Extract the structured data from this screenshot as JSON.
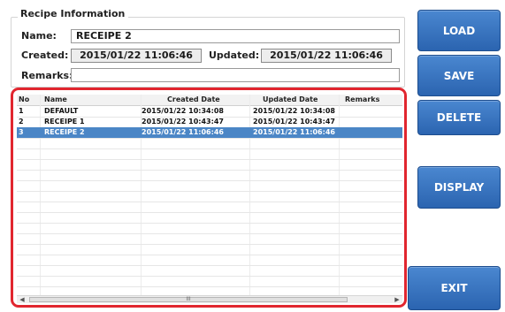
{
  "recipe_info": {
    "title": "Recipe Information",
    "name_label": "Name:",
    "name_value": "RECEIPE 2",
    "created_label": "Created:",
    "created_value": "2015/01/22 11:06:46",
    "updated_label": "Updated:",
    "updated_value": "2015/01/22 11:06:46",
    "remarks_label": "Remarks:",
    "remarks_value": ""
  },
  "table": {
    "columns": [
      "No",
      "Name",
      "Created Date",
      "Updated Date",
      "Remarks"
    ],
    "rows": [
      {
        "no": "1",
        "name": "DEFAULT",
        "created": "2015/01/22 10:34:08",
        "updated": "2015/01/22 10:34:08",
        "remarks": "",
        "selected": false
      },
      {
        "no": "2",
        "name": "RECEIPE 1",
        "created": "2015/01/22 10:43:47",
        "updated": "2015/01/22 10:43:47",
        "remarks": "",
        "selected": false
      },
      {
        "no": "3",
        "name": "RECEIPE 2",
        "created": "2015/01/22 11:06:46",
        "updated": "2015/01/22 11:06:46",
        "remarks": "",
        "selected": true
      }
    ],
    "scroll_thumb_label": "III",
    "highlight_color": "#e1262f",
    "selection_color": "#4b86c6"
  },
  "buttons": {
    "load": "LOAD",
    "save": "SAVE",
    "delete": "DELETE",
    "display": "DISPLAY",
    "exit": "EXIT"
  },
  "colors": {
    "button": "#2f6bb8"
  }
}
